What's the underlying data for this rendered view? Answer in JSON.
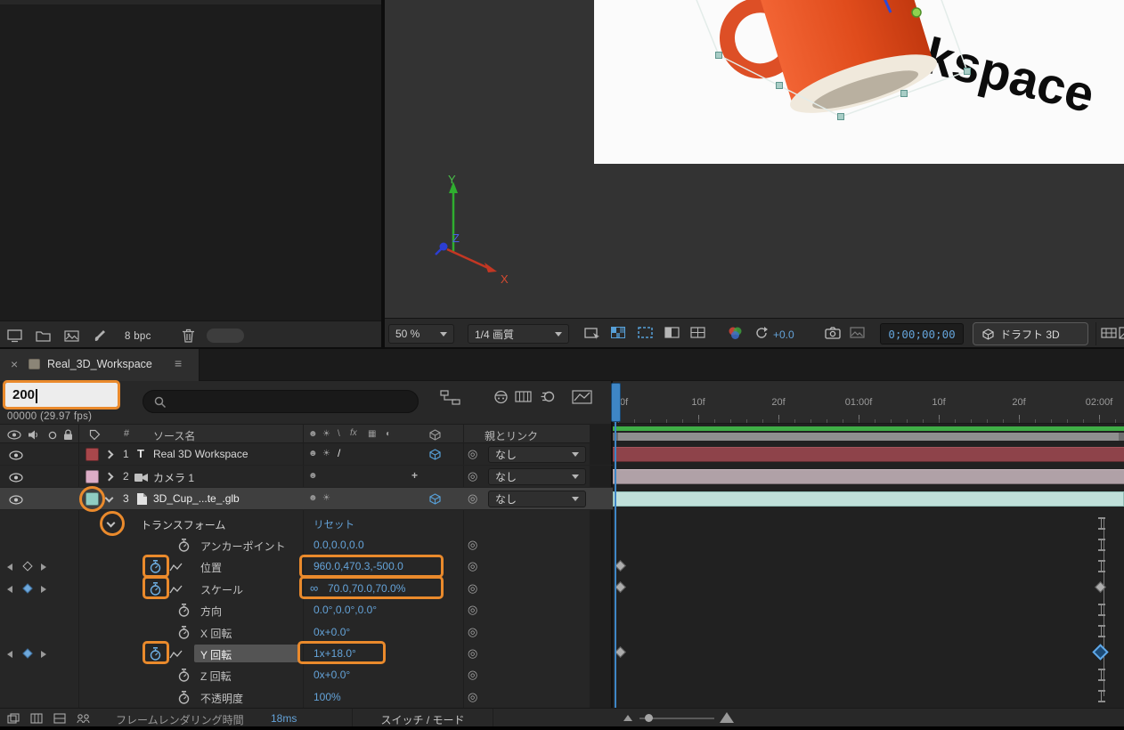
{
  "colors": {
    "accent_blue": "#64a3d9",
    "annotation_orange": "#ea8a2c",
    "cache_green": "#3fae46",
    "layer1_label": "#a8474b",
    "layer2_label": "#dcadc6",
    "layer3_label": "#8fccc2"
  },
  "left_panel": {
    "bit_depth_label": "8 bpc"
  },
  "viewer": {
    "zoom_value": "50 %",
    "quality_value": "1/4 画質",
    "exposure_value": "+0.0",
    "timecode": "0;00;00;00",
    "draft_3d_label": "ドラフト 3D",
    "canvas_text": "kspace",
    "axis": {
      "x": "X",
      "y": "Y",
      "z": "Z"
    }
  },
  "timeline": {
    "tab_title": "Real_3D_Workspace",
    "time_input_value": "200",
    "frame_display": "00000 (29.97 fps)",
    "columns": {
      "number": "#",
      "source_name": "ソース名",
      "parent_link": "親とリンク"
    },
    "layers": [
      {
        "number": "1",
        "glyph": "T",
        "name": "Real 3D Workspace",
        "parent_value": "なし"
      },
      {
        "number": "2",
        "name": "カメラ 1",
        "parent_value": "なし"
      },
      {
        "number": "3",
        "name": "3D_Cup_...te_.glb",
        "parent_value": "なし"
      }
    ],
    "transform_group": {
      "label": "トランスフォーム",
      "reset_label": "リセット"
    },
    "properties": [
      {
        "label": "アンカーポイント",
        "value": "0.0,0.0,0.0"
      },
      {
        "label": "位置",
        "value": "960.0,470.3,-500.0"
      },
      {
        "label": "スケール",
        "value": "70.0,70.0,70.0%"
      },
      {
        "label": "方向",
        "value": "0.0°,0.0°,0.0°"
      },
      {
        "label": "X 回転",
        "value": "0x+0.0°"
      },
      {
        "label": "Y 回転",
        "value": "1x+18.0°"
      },
      {
        "label": "Z 回転",
        "value": "0x+0.0°"
      },
      {
        "label": "不透明度",
        "value": "100%"
      }
    ],
    "ruler": [
      "0f",
      "10f",
      "20f",
      "01:00f",
      "10f",
      "20f",
      "02:00f"
    ],
    "footer": {
      "render_time_label": "フレームレンダリング時間",
      "render_time_value": "18ms",
      "switch_mode_label": "スイッチ / モード"
    }
  }
}
